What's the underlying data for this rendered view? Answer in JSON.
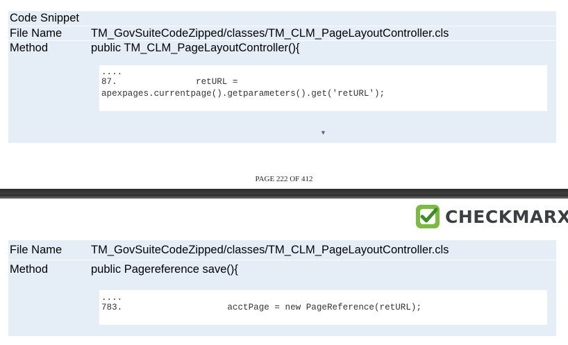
{
  "snippet1": {
    "heading": "Code Snippet",
    "file_label": "File Name",
    "file_value": "TM_GovSuiteCodeZipped/classes/TM_CLM_PageLayoutController.cls",
    "method_label": "Method",
    "method_value": "public TM_CLM_PageLayoutController(){",
    "code_lines": [
      "....",
      "87.               retURL =",
      "apexpages.currentpage().getparameters().get('retURL');"
    ],
    "expand_icon": "triangle-down-icon"
  },
  "footer": {
    "page_text": "PAGE 222 OF 412"
  },
  "logo": {
    "wordmark": "CHECKMARX",
    "icon": "checkmark-badge-icon",
    "colors": {
      "badge_green": "#7dba41",
      "text_dark": "#3a3f44"
    }
  },
  "snippet2": {
    "file_label": "File Name",
    "file_value": "TM_GovSuiteCodeZipped/classes/TM_CLM_PageLayoutController.cls",
    "method_label": "Method",
    "method_value": "public Pagereference save(){",
    "code_lines": [
      "....",
      "783.                    acctPage = new PageReference(retURL);"
    ]
  },
  "colors": {
    "panel_bg": "#e5eef7",
    "divider": "#2f2f2f"
  }
}
